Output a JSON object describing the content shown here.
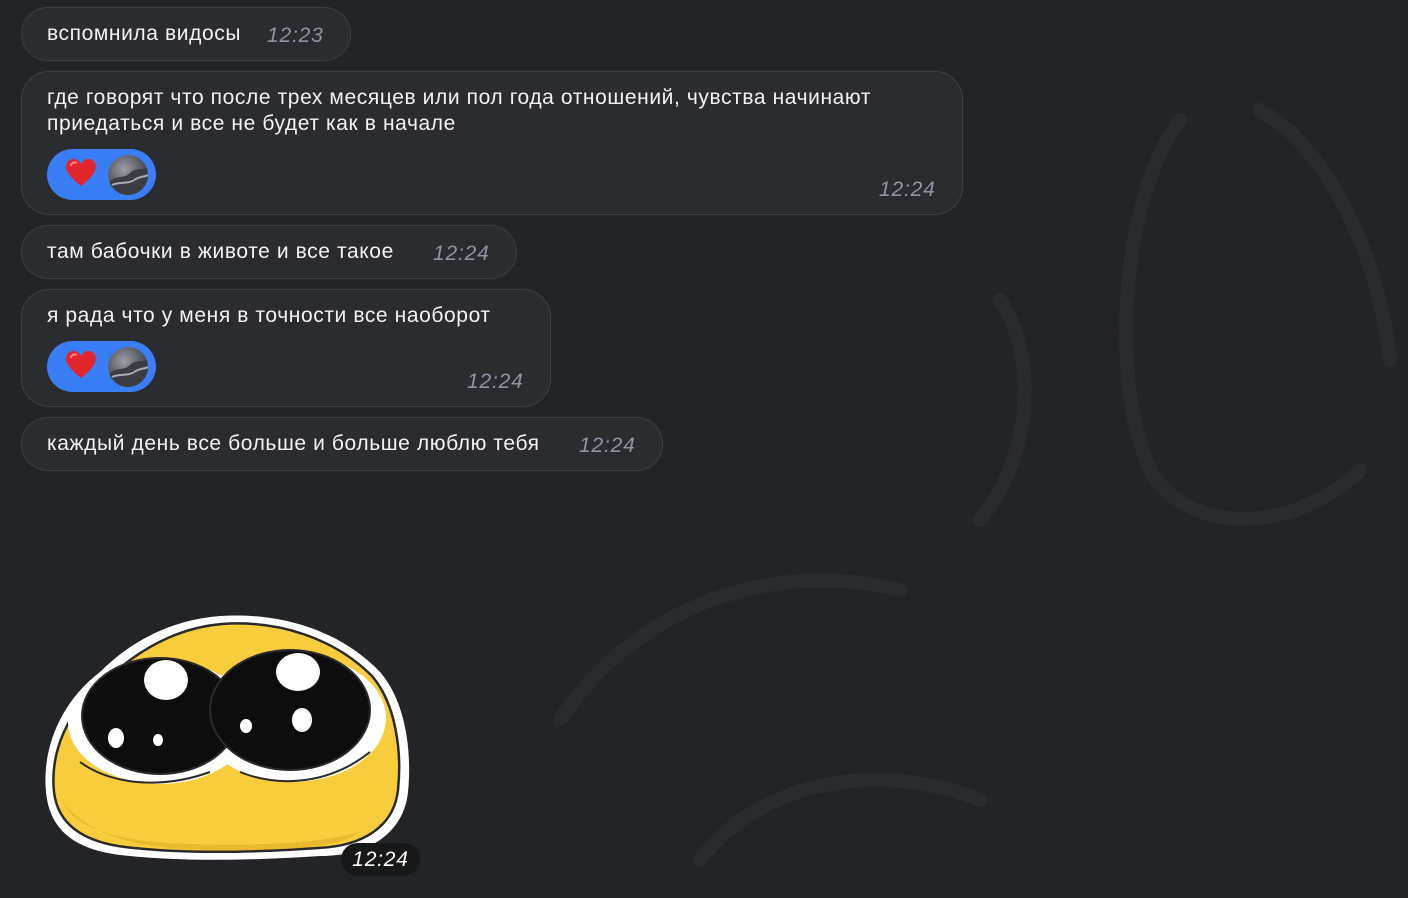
{
  "messages": [
    {
      "text": "вспомнила видосы",
      "time": "12:23"
    },
    {
      "text": "где говорят что после трех месяцев или пол года отношений, чувства начинают приедаться и все не будет как в начале",
      "time": "12:24",
      "reaction": "heart"
    },
    {
      "text": "там бабочки в животе и все такое",
      "time": "12:24"
    },
    {
      "text": "я рада что у меня в точности все наоборот",
      "time": "12:24",
      "reaction": "heart"
    },
    {
      "text": "каждый день все больше и больше люблю тебя",
      "time": "12:24"
    }
  ],
  "sticker": {
    "icon": "pleading-emoji-sticker",
    "time": "12:24"
  },
  "colors": {
    "background": "#232427",
    "bubble": "#2b2c2f",
    "reaction_pill": "#3a7ef5",
    "heart": "#e3262c",
    "time_text": "#8e94a6"
  }
}
